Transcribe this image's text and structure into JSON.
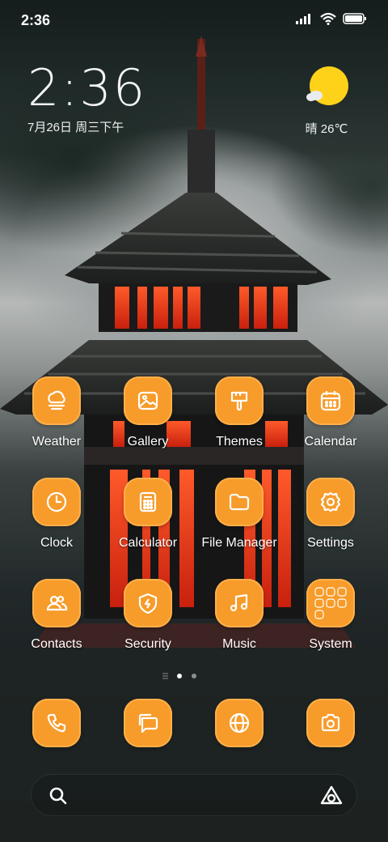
{
  "status_bar": {
    "time": "2:36",
    "icons": [
      "signal-icon",
      "wifi-icon",
      "battery-icon"
    ]
  },
  "clock_widget": {
    "time": "2:36",
    "date": "7月26日 周三下午"
  },
  "weather_widget": {
    "condition_icon": "sunny-icon",
    "text": "晴 26℃"
  },
  "apps": [
    {
      "label": "Weather",
      "icon": "weather-icon"
    },
    {
      "label": "Gallery",
      "icon": "gallery-icon"
    },
    {
      "label": "Themes",
      "icon": "brush-icon"
    },
    {
      "label": "Calendar",
      "icon": "calendar-icon"
    },
    {
      "label": "Clock",
      "icon": "clock-icon"
    },
    {
      "label": "Calculator",
      "icon": "calculator-icon"
    },
    {
      "label": "File Manager",
      "icon": "folder-icon"
    },
    {
      "label": "Settings",
      "icon": "gear-icon"
    },
    {
      "label": "Contacts",
      "icon": "contacts-icon"
    },
    {
      "label": "Security",
      "icon": "shield-icon"
    },
    {
      "label": "Music",
      "icon": "music-icon"
    },
    {
      "label": "System",
      "icon": "folder-grid-icon"
    }
  ],
  "page_indicator": {
    "pages": 2,
    "current": 1
  },
  "dock": [
    {
      "icon": "phone-icon"
    },
    {
      "icon": "messages-icon"
    },
    {
      "icon": "browser-icon"
    },
    {
      "icon": "camera-icon"
    }
  ],
  "search_bar": {
    "left_icon": "search-icon",
    "right_icon": "assistant-icon"
  },
  "colors": {
    "accent": "#f79b2a",
    "accent_border": "#ffb04a",
    "sun": "#ffd21a"
  }
}
